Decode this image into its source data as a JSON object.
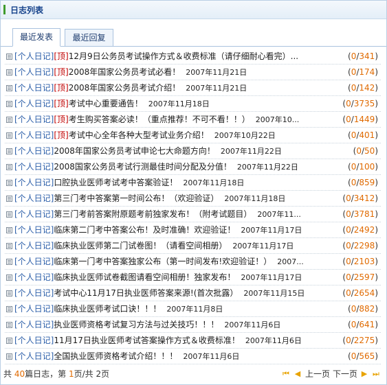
{
  "panel": {
    "title": "日志列表"
  },
  "tabs": [
    {
      "label": "最近发表"
    },
    {
      "label": "最近回复"
    }
  ],
  "rows": [
    {
      "cat": "[个人日记]",
      "top": "[顶]",
      "title": "12月9日公务员考试操作方式＆收费标准（请仔细耐心看完）...",
      "date": "",
      "c1": "0",
      "c2": "341"
    },
    {
      "cat": "[个人日记]",
      "top": "[顶]",
      "title": "2008年国家公务员考试必看！",
      "date": "2007年11月21日",
      "c1": "0",
      "c2": "174"
    },
    {
      "cat": "[个人日记]",
      "top": "[顶]",
      "title": "2008年国家公务员考试介绍！",
      "date": "2007年11月21日",
      "c1": "0",
      "c2": "142"
    },
    {
      "cat": "[个人日记]",
      "top": "[顶]",
      "title": "考试中心重要通告！",
      "date": "2007年11月18日",
      "c1": "0",
      "c2": "3735"
    },
    {
      "cat": "[个人日记]",
      "top": "[顶]",
      "title": "考生购买答案必读！（重点推荐！不可不看！！）",
      "date": "2007年10...",
      "c1": "0",
      "c2": "1449"
    },
    {
      "cat": "[个人日记]",
      "top": "[顶]",
      "title": "考试中心全年各种大型考试业务介绍！",
      "date": "2007年10月22日",
      "c1": "0",
      "c2": "401"
    },
    {
      "cat": "[个人日记]",
      "top": "",
      "title": "2008年国家公务员考试申论七大命题方向！",
      "date": "2007年11月22日",
      "c1": "0",
      "c2": "50"
    },
    {
      "cat": "[个人日记]",
      "top": "",
      "title": "2008国家公务员考试行测最佳时间分配及分值！",
      "date": "2007年11月22日",
      "c1": "0",
      "c2": "100"
    },
    {
      "cat": "[个人日记]",
      "top": "",
      "title": "口腔执业医师考试考中答案验证！",
      "date": "2007年11月18日",
      "c1": "0",
      "c2": "859"
    },
    {
      "cat": "[个人日记]",
      "top": "",
      "title": "第三门考中答案第一时间公布！（欢迎验证）",
      "date": "2007年11月18日",
      "c1": "0",
      "c2": "3412"
    },
    {
      "cat": "[个人日记]",
      "top": "",
      "title": "第三门考前答案附原题考前独家发布！（附考试题目）",
      "date": "2007年11...",
      "c1": "0",
      "c2": "3781"
    },
    {
      "cat": "[个人日记]",
      "top": "",
      "title": "临床第二门考中答案公布！及时准确！欢迎验证！",
      "date": "2007年11月17日",
      "c1": "0",
      "c2": "2492"
    },
    {
      "cat": "[个人日记]",
      "top": "",
      "title": "临床执业医师第二门试卷图！（请看空间相册）",
      "date": "2007年11月17日",
      "c1": "0",
      "c2": "2298"
    },
    {
      "cat": "[个人日记]",
      "top": "",
      "title": "临床第一门考中答案独家公布（第一时间发布!欢迎验证！）",
      "date": "2007...",
      "c1": "0",
      "c2": "2103"
    },
    {
      "cat": "[个人日记]",
      "top": "",
      "title": "临床执业医师试卷截图请看空间相册！独家发布！",
      "date": "2007年11月17日",
      "c1": "0",
      "c2": "2597"
    },
    {
      "cat": "[个人日记]",
      "top": "",
      "title": "考试中心11月17日执业医师答案来源!(首次批露）",
      "date": "2007年11月15日",
      "c1": "0",
      "c2": "2654"
    },
    {
      "cat": "[个人日记]",
      "top": "",
      "title": "临床执业医师考试口诀！！！",
      "date": "2007年11月8日",
      "c1": "0",
      "c2": "882"
    },
    {
      "cat": "[个人日记]",
      "top": "",
      "title": "执业医师资格考试复习方法与过关技巧！！！",
      "date": "2007年11月6日",
      "c1": "0",
      "c2": "641"
    },
    {
      "cat": "[个人日记]",
      "top": "",
      "title": "11月17日执业医师考试答案操作方式＆收费标准！",
      "date": "2007年11月6日",
      "c1": "0",
      "c2": "2275"
    },
    {
      "cat": "[个人日记]",
      "top": "",
      "title": "全国执业医师资格考试介绍！！！",
      "date": "2007年11月6日",
      "c1": "0",
      "c2": "565"
    }
  ],
  "pager": {
    "prefix": "共 ",
    "total": "40",
    "mid1": "篇日志，第 ",
    "page": "1",
    "mid2": "页/共 ",
    "pages": "2",
    "suffix": "页",
    "prev_label": "上一页",
    "next_label": "下一页",
    "first_icon": "first-page-icon",
    "prev_icon": "prev-page-icon",
    "next_icon": "next-page-icon",
    "last_icon": "last-page-icon"
  }
}
